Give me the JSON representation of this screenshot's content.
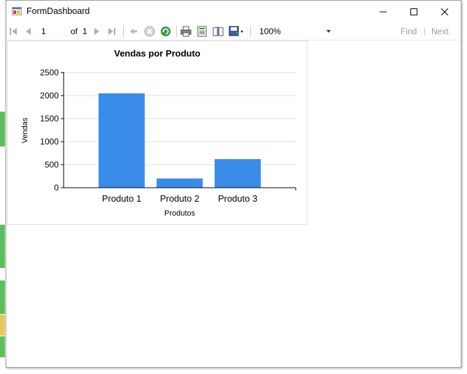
{
  "window": {
    "title": "FormDashboard"
  },
  "toolbar": {
    "page_current": "1",
    "of_label": "of",
    "page_total": "1",
    "zoom": "100%",
    "find_label": "Find",
    "next_label": "Next"
  },
  "colors": {
    "bar": "#3a8ceb",
    "accent_green": "#5bbf5b"
  },
  "chart_data": {
    "type": "bar",
    "title": "Vendas por Produto",
    "xlabel": "Produtos",
    "ylabel": "Vendas",
    "categories": [
      "Produto 1",
      "Produto 2",
      "Produto 3"
    ],
    "values": [
      2050,
      200,
      620
    ],
    "ylim": [
      0,
      2500
    ],
    "yticks": [
      "0",
      "500",
      "1000",
      "1500",
      "2000",
      "2500"
    ],
    "grid": true
  }
}
